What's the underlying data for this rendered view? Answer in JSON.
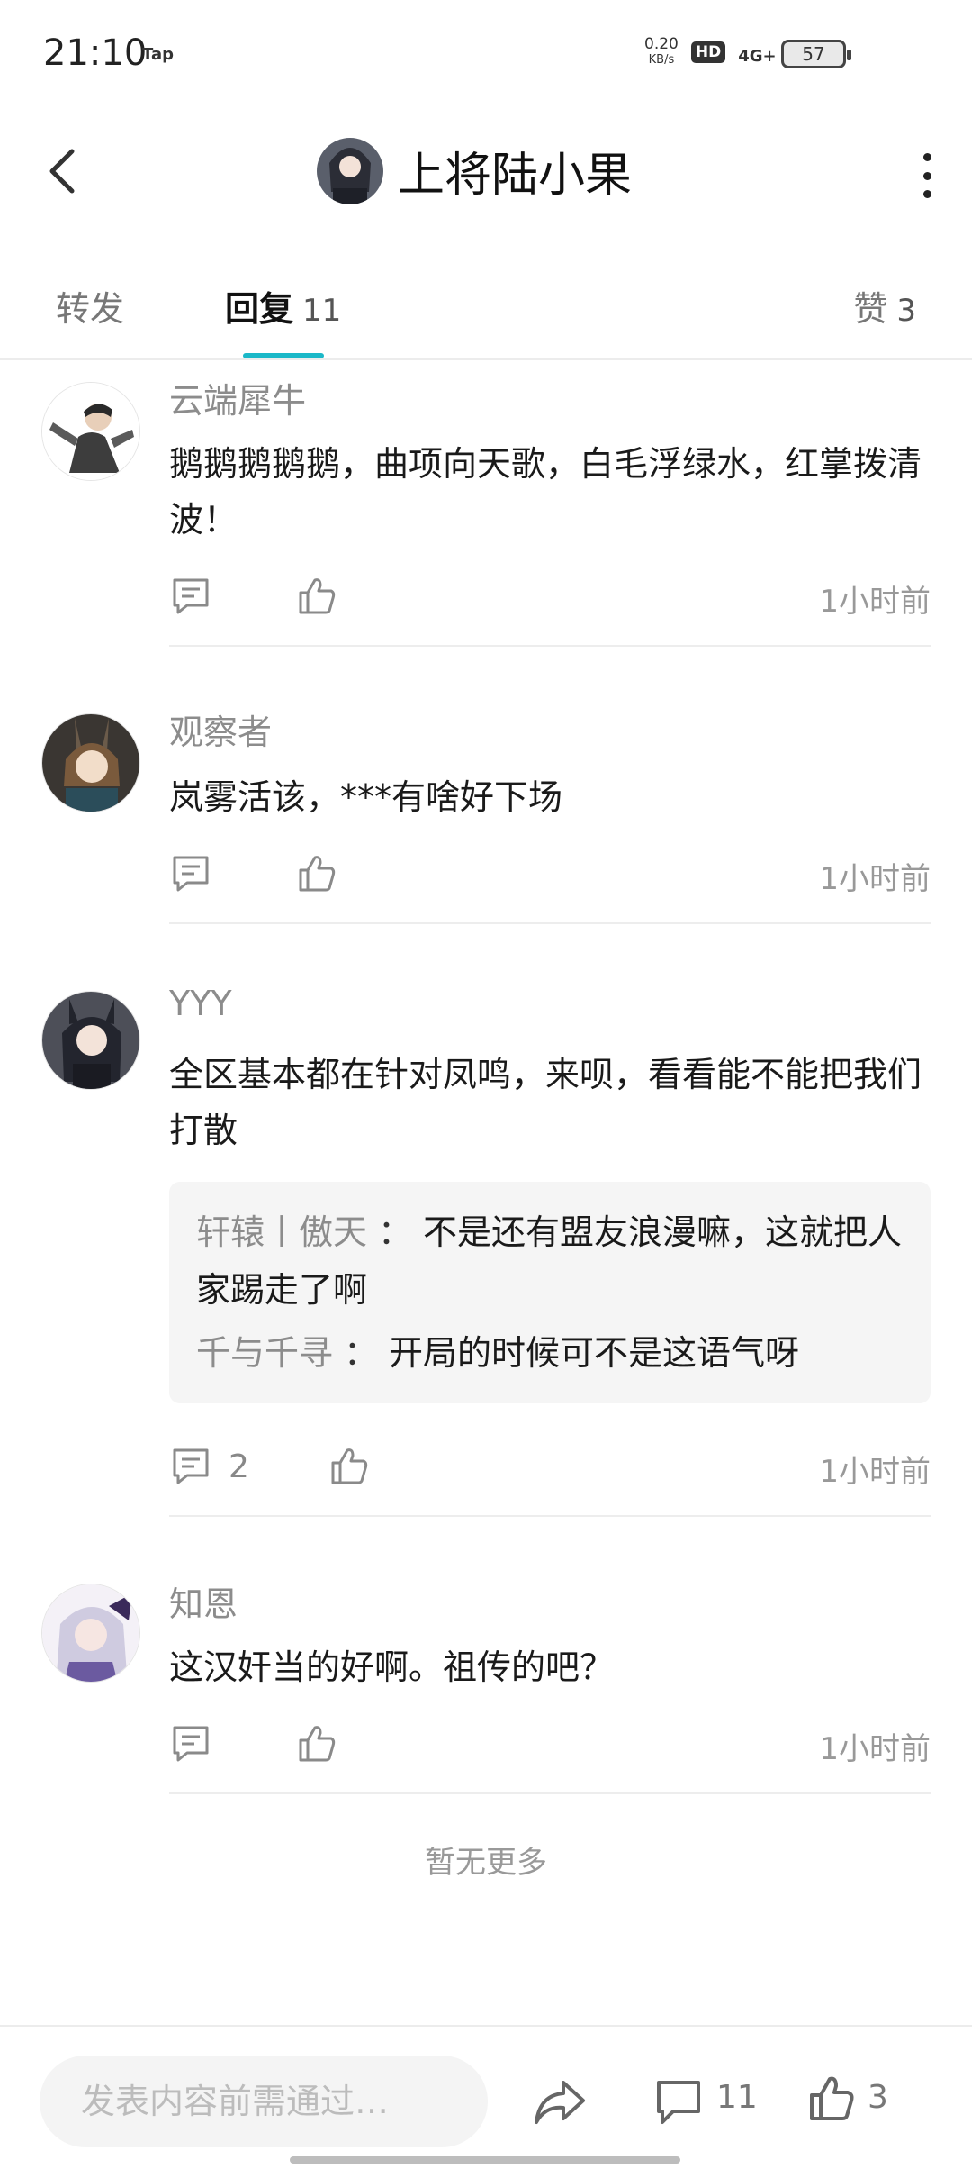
{
  "status_bar": {
    "time": "21:10",
    "tap": "Tap",
    "net_speed_value": "0.20",
    "net_speed_unit": "KB/s",
    "hd": "HD",
    "network": "4G+",
    "battery": "57"
  },
  "header": {
    "title": "上将陆小果"
  },
  "tabs": {
    "repost_label": "转发",
    "reply_label": "回复",
    "reply_count": "11",
    "like_label": "赞",
    "like_count": "3"
  },
  "comments": [
    {
      "name": "云端犀牛",
      "text": "鹅鹅鹅鹅鹅，曲项向天歌，白毛浮绿水，红掌拨清波！",
      "time": "1小时前"
    },
    {
      "name": "观察者",
      "text": "岚雾活该，***有啥好下场",
      "time": "1小时前"
    },
    {
      "name": "YYY",
      "text": "全区基本都在针对凤鸣，来呗，看看能不能把我们打散",
      "time": "1小时前",
      "reply_count": "2",
      "subreplies": [
        {
          "name": "轩辕丨傲天",
          "sep": "：",
          "text": "不是还有盟友浪漫嘛，这就把人家踢走了啊"
        },
        {
          "name": "千与千寻",
          "sep": "：",
          "text": "开局的时候可不是这语气呀"
        }
      ]
    },
    {
      "name": "知恩",
      "text": "这汉奸当的好啊。祖传的吧？",
      "time": "1小时前"
    }
  ],
  "no_more": "暂无更多",
  "bottom_bar": {
    "input_placeholder": "发表内容前需通过…",
    "comment_count": "11",
    "like_count": "3"
  },
  "colors": {
    "accent": "#1bb8c8",
    "muted_text": "#8c8c8c",
    "divider": "#ededed"
  },
  "icons": [
    "back-arrow-icon",
    "more-vertical-icon",
    "comment-icon",
    "thumbs-up-icon",
    "share-icon"
  ]
}
